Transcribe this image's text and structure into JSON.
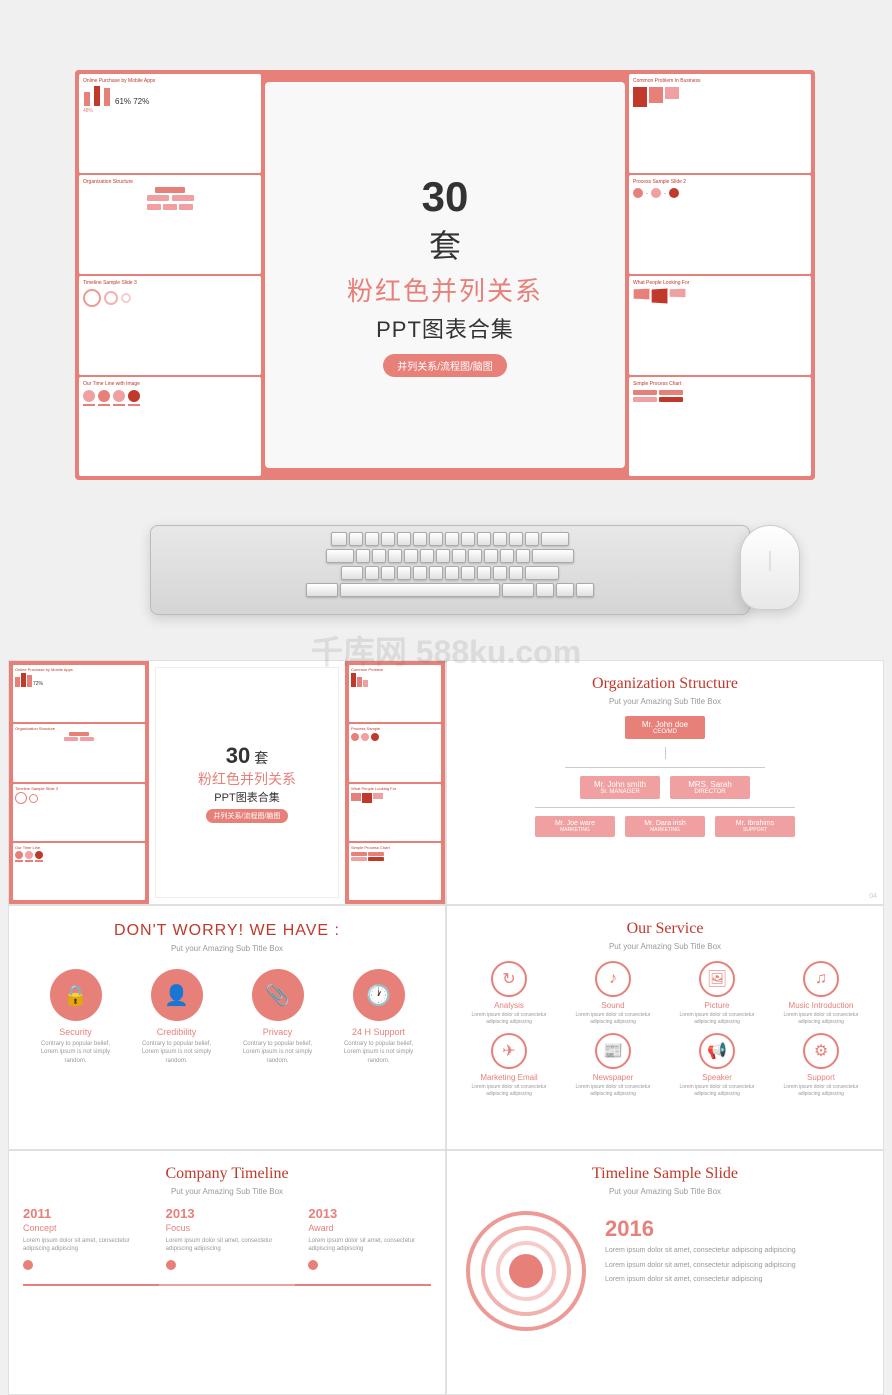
{
  "top_banner": {
    "number": "30",
    "unit": "套",
    "title_cn": "粉红色并列关系",
    "subtitle": "PPT图表合集",
    "badge": "并列关系/流程图/脑图"
  },
  "slides": {
    "panel1": {
      "number": "30",
      "unit": "套",
      "title_cn": "粉红色并列关系",
      "subtitle": "PPT图表合集",
      "badge": "并列关系/流程图/脑图"
    },
    "panel2": {
      "title": "Organization Structure",
      "subtitle": "Put your Amazing Sub Title Box",
      "ceo": {
        "name": "Mr. John doe",
        "role": "CEO/MD"
      },
      "managers": [
        {
          "name": "Mr. John smith",
          "role": "Sr. MANAGER"
        },
        {
          "name": "MRS. Sarah",
          "role": "DIRECTOR"
        }
      ],
      "staff": [
        {
          "name": "Mr. Joe ware",
          "role": "MARKETING"
        },
        {
          "name": "Mr. Dara irish",
          "role": "MARKETING"
        },
        {
          "name": "Mr. Ibrahims",
          "role": "SUPPORT"
        }
      ],
      "page_num": "04"
    },
    "panel3": {
      "title": "DON'T WORRY! WE HAVE :",
      "subtitle": "Put your Amazing Sub Title Box",
      "items": [
        {
          "icon": "🔒",
          "label": "Security",
          "text": "Contrary to popular belief, Lorem ipsum is not simply random."
        },
        {
          "icon": "👤",
          "label": "Credibility",
          "text": "Contrary to popular belief, Lorem ipsum is not simply random."
        },
        {
          "icon": "📎",
          "label": "Privacy",
          "text": "Contrary to popular belief, Lorem ipsum is not simply random."
        },
        {
          "icon": "🕐",
          "label": "24 H Support",
          "text": "Contrary to popular belief, Lorem ipsum is not simply random."
        }
      ]
    },
    "panel4": {
      "title": "Our Service",
      "subtitle": "Put your Amazing Sub Title Box",
      "services": [
        {
          "icon": "↻",
          "name": "Analysis",
          "desc": "Lorem ipsum dolor sit consectetur adipiscing adipiscing"
        },
        {
          "icon": "♪",
          "name": "Sound",
          "desc": "Lorem ipsum dolor sit consectetur adipiscing adipiscing"
        },
        {
          "icon": "🖼",
          "name": "Picture",
          "desc": "Lorem ipsum dolor sit consectetur adipiscing adipiscing"
        },
        {
          "icon": "♫",
          "name": "Music Introduction",
          "desc": "Lorem ipsum dolor sit consectetur adipiscing adipiscing"
        },
        {
          "icon": "✈",
          "name": "Marketing Email",
          "desc": "Lorem ipsum dolor sit consectetur adipiscing adipiscing"
        },
        {
          "icon": "📰",
          "name": "Newspaper",
          "desc": "Lorem ipsum dolor sit consectetur adipiscing adipiscing"
        },
        {
          "icon": "📢",
          "name": "Speaker",
          "desc": "Lorem ipsum dolor sit consectetur adipiscing adipiscing"
        },
        {
          "icon": "⚙",
          "name": "Support",
          "desc": "Lorem ipsum dolor sit consectetur adipiscing adipiscing"
        }
      ]
    },
    "panel5": {
      "title": "Company Timeline",
      "subtitle": "Put your Amazing Sub Title Box",
      "items": [
        {
          "year": "2011",
          "event": "Concept",
          "text": "Lorem ipsum dolor sit amet, consectetur adipiscing adipiscing"
        },
        {
          "year": "2013",
          "event": "Focus",
          "text": "Lorem ipsum dolor sit amet, consectetur adipiscing adipiscing"
        },
        {
          "year": "2013",
          "event": "Award",
          "text": "Lorem ipsum dolor sit amet, consectetur adipiscing adipiscing"
        }
      ]
    },
    "panel6": {
      "title": "Timeline Sample Slide",
      "subtitle": "Put your Amazing Sub Title Box",
      "year": "2016",
      "text": "Lorem ipsum dolor sit amet, consectetur adipiscing adipiscing"
    }
  },
  "watermark": "千库网 588ku.com"
}
